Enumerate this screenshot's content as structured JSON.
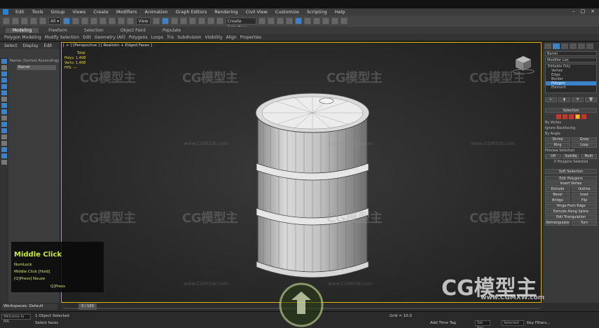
{
  "app": {
    "menu": [
      "Edit",
      "Tools",
      "Group",
      "Views",
      "Create",
      "Modifiers",
      "Animation",
      "Graph Editors",
      "Rendering",
      "Civil View",
      "Customize",
      "Scripting",
      "Help"
    ],
    "toolbar_dropdown": "View",
    "toolbar_dropdown2": "Create Selection Se..."
  },
  "ribbon": {
    "tabs": [
      "Modeling",
      "Freeform",
      "Selection",
      "Object Paint",
      "Populate"
    ],
    "active_tab": "Modeling",
    "items": [
      "Polygon Modeling",
      "Modify Selection",
      "Edit",
      "Geometry (All)",
      "Polygons",
      "Loops",
      "Tris",
      "Subdivision",
      "Visibility",
      "Align",
      "Properties"
    ]
  },
  "scene_explorer": {
    "tabs": [
      "Select",
      "Display",
      "Edit"
    ],
    "root_label": "Name (Sorted Ascending)",
    "selected_item": "Barrel"
  },
  "viewport": {
    "label": "[ + ] [Perspective ] [ Realistic + Edged Faces ]",
    "stats_header": "Total",
    "stats": [
      "Polys:  1,408",
      "Verts:  1,408"
    ],
    "fps": "FPS:  ---"
  },
  "watermarks": {
    "logo_text": "CG模型主",
    "url": "www.CGMXW.com",
    "big_logo": "CG模型主",
    "big_url": "www.CGMXW.com"
  },
  "hint": {
    "title": "Middle Click",
    "lines": [
      "NumLock",
      "Middle Click [Hold]",
      "[Q]Press] Nauze",
      "Q]Press"
    ]
  },
  "command_panel": {
    "object_name": "Barrel",
    "modifier_list": "Modifier List",
    "stack": [
      "Editable Poly",
      "Vertex",
      "Edge",
      "Border",
      "Polygon",
      "Element"
    ],
    "selected_stack": "Polygon",
    "sections": {
      "selection": "Selection",
      "soft_selection": "Soft Selection",
      "edit_polygons": "Edit Polygons",
      "edit_triangulation": "Edit Triangulation"
    },
    "selection_rows": [
      "By Vertex",
      "Ignore Backfacing",
      "By Angle:",
      "Shrink",
      "Grow",
      "Ring",
      "Loop",
      "Preview Selection",
      "Off",
      "SubObj",
      "Multi",
      "0 Polygons Selected"
    ],
    "edit_polygon_buttons": [
      "Insert Vertex",
      "Extrude",
      "Outline",
      "Bevel",
      "Inset",
      "Bridge",
      "Flip",
      "Hinge From Edge",
      "Extrude Along Spline",
      "Edit Triangulation",
      "Retriangulate",
      "Turn"
    ]
  },
  "timeline": {
    "workspace": "Workspaces: Default",
    "frame": "0 / 100"
  },
  "status": {
    "welcome": "Welcome to MA",
    "selected": "1 Object Selected",
    "prompt": "Select faces",
    "coords": "Grid = 10.0",
    "add_time_tag": "Add Time Tag",
    "setkey": "Set Key",
    "selected_dd": "Selected",
    "key_filters": "Key Filters..."
  }
}
